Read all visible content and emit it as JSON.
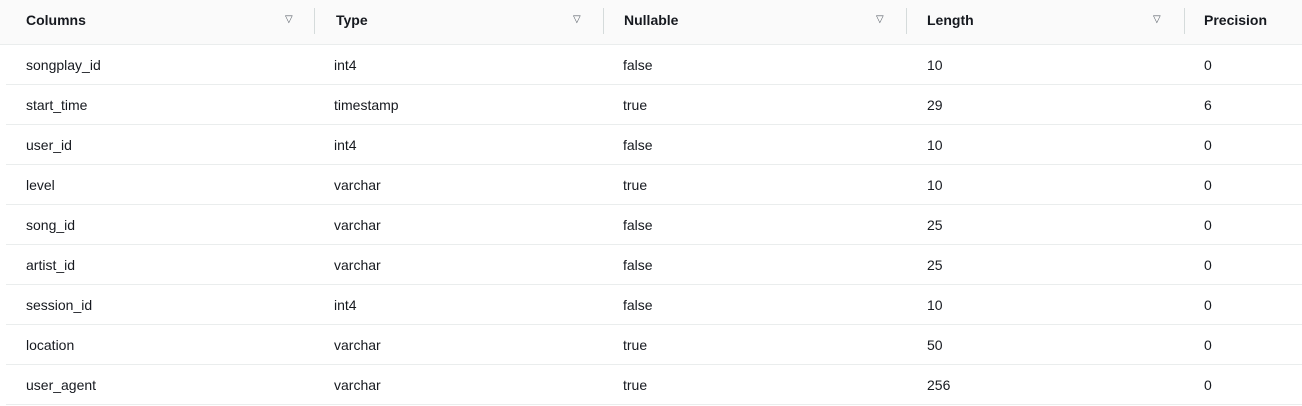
{
  "table": {
    "columns": [
      {
        "label": "Columns",
        "sort_icon": "sort-triangle-icon"
      },
      {
        "label": "Type",
        "sort_icon": "sort-triangle-icon"
      },
      {
        "label": "Nullable",
        "sort_icon": "sort-triangle-icon"
      },
      {
        "label": "Length",
        "sort_icon": "sort-triangle-icon"
      },
      {
        "label": "Precision"
      }
    ],
    "sort_glyph": "▽",
    "rows": [
      {
        "column": "songplay_id",
        "type": "int4",
        "nullable": "false",
        "length": "10",
        "precision": "0"
      },
      {
        "column": "start_time",
        "type": "timestamp",
        "nullable": "true",
        "length": "29",
        "precision": "6"
      },
      {
        "column": "user_id",
        "type": "int4",
        "nullable": "false",
        "length": "10",
        "precision": "0"
      },
      {
        "column": "level",
        "type": "varchar",
        "nullable": "true",
        "length": "10",
        "precision": "0"
      },
      {
        "column": "song_id",
        "type": "varchar",
        "nullable": "false",
        "length": "25",
        "precision": "0"
      },
      {
        "column": "artist_id",
        "type": "varchar",
        "nullable": "false",
        "length": "25",
        "precision": "0"
      },
      {
        "column": "session_id",
        "type": "int4",
        "nullable": "false",
        "length": "10",
        "precision": "0"
      },
      {
        "column": "location",
        "type": "varchar",
        "nullable": "true",
        "length": "50",
        "precision": "0"
      },
      {
        "column": "user_agent",
        "type": "varchar",
        "nullable": "true",
        "length": "256",
        "precision": "0"
      }
    ]
  }
}
